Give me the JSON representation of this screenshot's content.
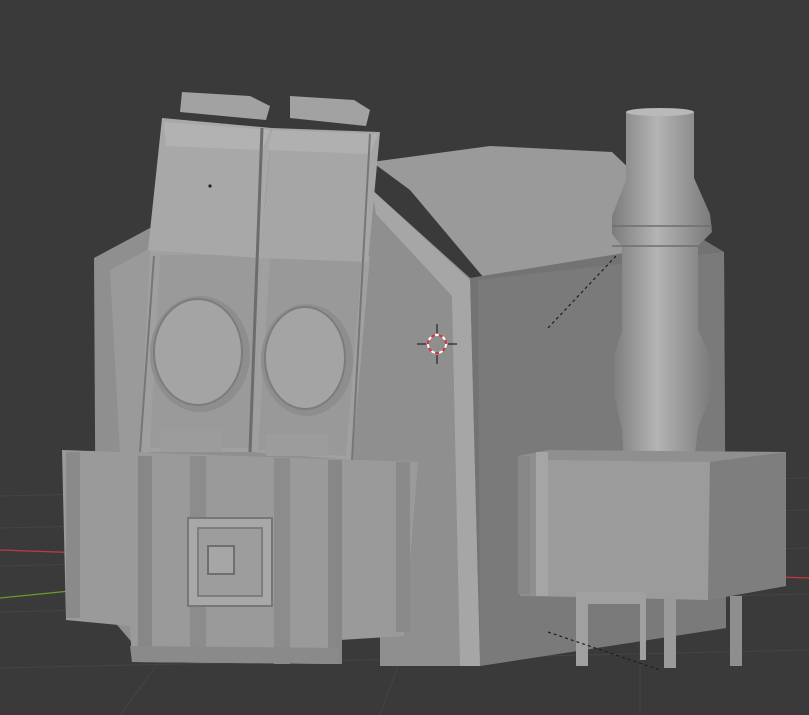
{
  "viewport": {
    "background": "#3a3a3a",
    "grid_color": "#454545",
    "x_axis_color": "#c0393f",
    "y_axis_color": "#6a9a2b",
    "model_light": "#a3a3a3",
    "model_mid": "#8e8e8e",
    "model_dark": "#6e6e6e",
    "cursor_color": "#d8323a"
  },
  "objects": [
    {
      "name": "machine-body",
      "kind": "mesh"
    },
    {
      "name": "twin-lid-cylinders",
      "kind": "mesh"
    },
    {
      "name": "exhaust-stack",
      "kind": "mesh"
    },
    {
      "name": "side-box-with-legs",
      "kind": "mesh"
    }
  ],
  "cursor": {
    "icon": "3d-cursor-icon"
  }
}
